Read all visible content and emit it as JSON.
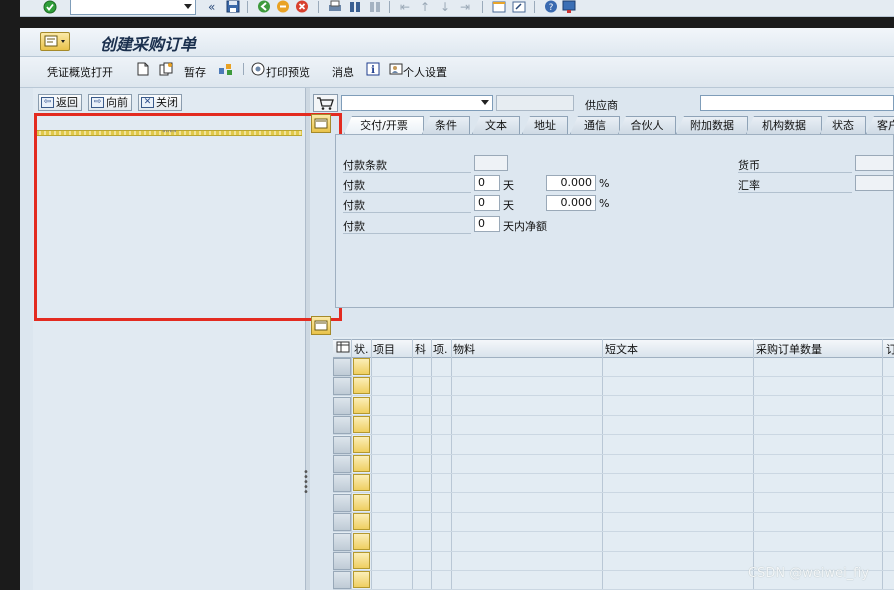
{
  "title": "创建采购订单",
  "app_toolbar": {
    "doc_overview": "凭证概览打开",
    "hold": "暂存",
    "print_preview": "打印预览",
    "messages": "消息",
    "personal_settings": "个人设置"
  },
  "nav": {
    "back": "返回",
    "forward": "向前",
    "close": "关闭"
  },
  "header": {
    "vendor_label": "供应商"
  },
  "tabs": [
    {
      "label": "交付/开票",
      "active": true
    },
    {
      "label": "条件",
      "active": false
    },
    {
      "label": "文本",
      "active": false
    },
    {
      "label": "地址",
      "active": false
    },
    {
      "label": "通信",
      "active": false
    },
    {
      "label": "合伙人",
      "active": false
    },
    {
      "label": "附加数据",
      "active": false
    },
    {
      "label": "机构数据",
      "active": false
    },
    {
      "label": "状态",
      "active": false
    },
    {
      "label": "客户",
      "active": false
    }
  ],
  "delivery": {
    "payment_terms_label": "付款条款",
    "payment_label": "付款",
    "rows": [
      {
        "label": "付款",
        "days": "0",
        "day_unit": "天",
        "percent": "0.000",
        "pct_sign": "%"
      },
      {
        "label": "付款",
        "days": "0",
        "day_unit": "天",
        "percent": "0.000",
        "pct_sign": "%"
      },
      {
        "label": "付款",
        "days": "0",
        "day_unit": "天内净额"
      }
    ],
    "currency_label": "货币",
    "exchange_rate_label": "汇率"
  },
  "item_table": {
    "columns": [
      "状.",
      "项目",
      "科",
      "项.",
      "物料",
      "短文本",
      "采购订单数量",
      "订"
    ],
    "row_count": 12
  },
  "watermark": "CSDN @weiwei_fiy",
  "colors": {
    "highlight": "#e32b20",
    "pane_bg": "#e1eaf2",
    "status_yellow": "#efcf62"
  }
}
